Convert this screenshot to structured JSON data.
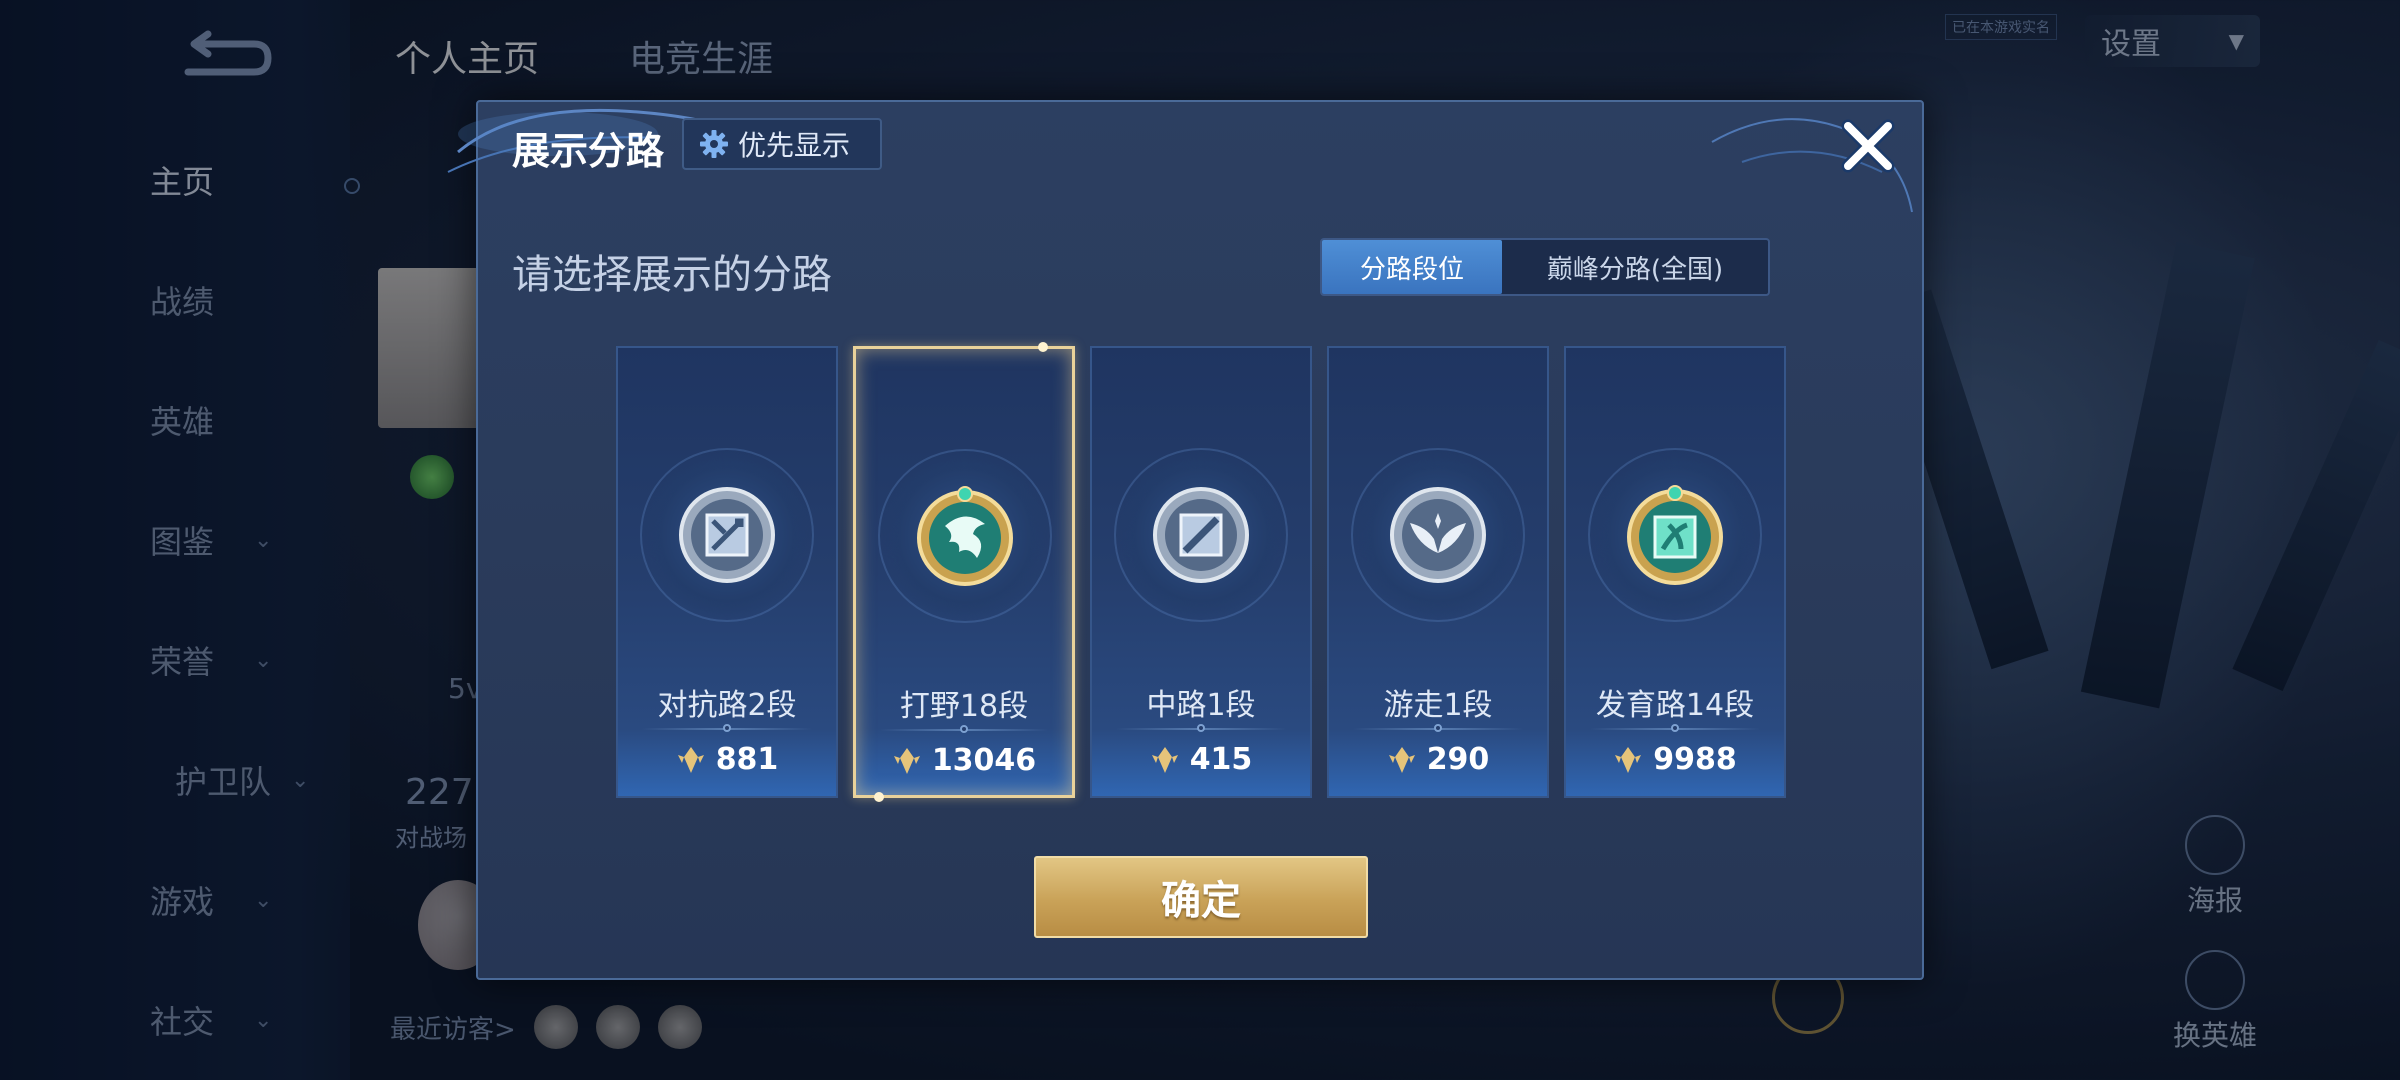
{
  "nav": {
    "items": [
      {
        "label": "主页",
        "active": true,
        "chevron": false
      },
      {
        "label": "战绩",
        "active": false,
        "chevron": false
      },
      {
        "label": "英雄",
        "active": false,
        "chevron": false
      },
      {
        "label": "图鉴",
        "active": false,
        "chevron": true
      },
      {
        "label": "荣誉",
        "active": false,
        "chevron": true
      },
      {
        "label": "护卫队",
        "active": false,
        "chevron": true
      },
      {
        "label": "游戏",
        "active": false,
        "chevron": true
      },
      {
        "label": "社交",
        "active": false,
        "chevron": true
      }
    ]
  },
  "top_tabs": [
    "个人主页",
    "电竞生涯"
  ],
  "settings_label": "设置",
  "badge_text": "已在本游戏实名",
  "background_text": {
    "fragment_1": "5v",
    "fragment_2": "227",
    "fragment_3": "对战场",
    "visitors_label": "最近访客>"
  },
  "right_buttons": [
    "海报",
    "换英雄"
  ],
  "modal": {
    "title": "展示分路",
    "priority_label": "优先显示",
    "subtitle": "请选择展示的分路",
    "segment": {
      "options": [
        "分路段位",
        "巅峰分路(全国)"
      ],
      "selected": "分路段位"
    },
    "cards": [
      {
        "lane": "对抗路2段",
        "score": "881",
        "emblem": "silver-sword-emblem",
        "selected": false
      },
      {
        "lane": "打野18段",
        "score": "13046",
        "emblem": "gold-dragon-emblem",
        "selected": true
      },
      {
        "lane": "中路1段",
        "score": "415",
        "emblem": "silver-wand-emblem",
        "selected": false
      },
      {
        "lane": "游走1段",
        "score": "290",
        "emblem": "silver-wings-emblem",
        "selected": false
      },
      {
        "lane": "发育路14段",
        "score": "9988",
        "emblem": "gold-arrow-emblem",
        "selected": false
      }
    ],
    "confirm_label": "确定"
  },
  "colors": {
    "modal_bg": "#2a3b5b",
    "selected_border": "#e9d29a",
    "segment_active": "#4f8fd6",
    "confirm_gold": "#c9a258"
  }
}
